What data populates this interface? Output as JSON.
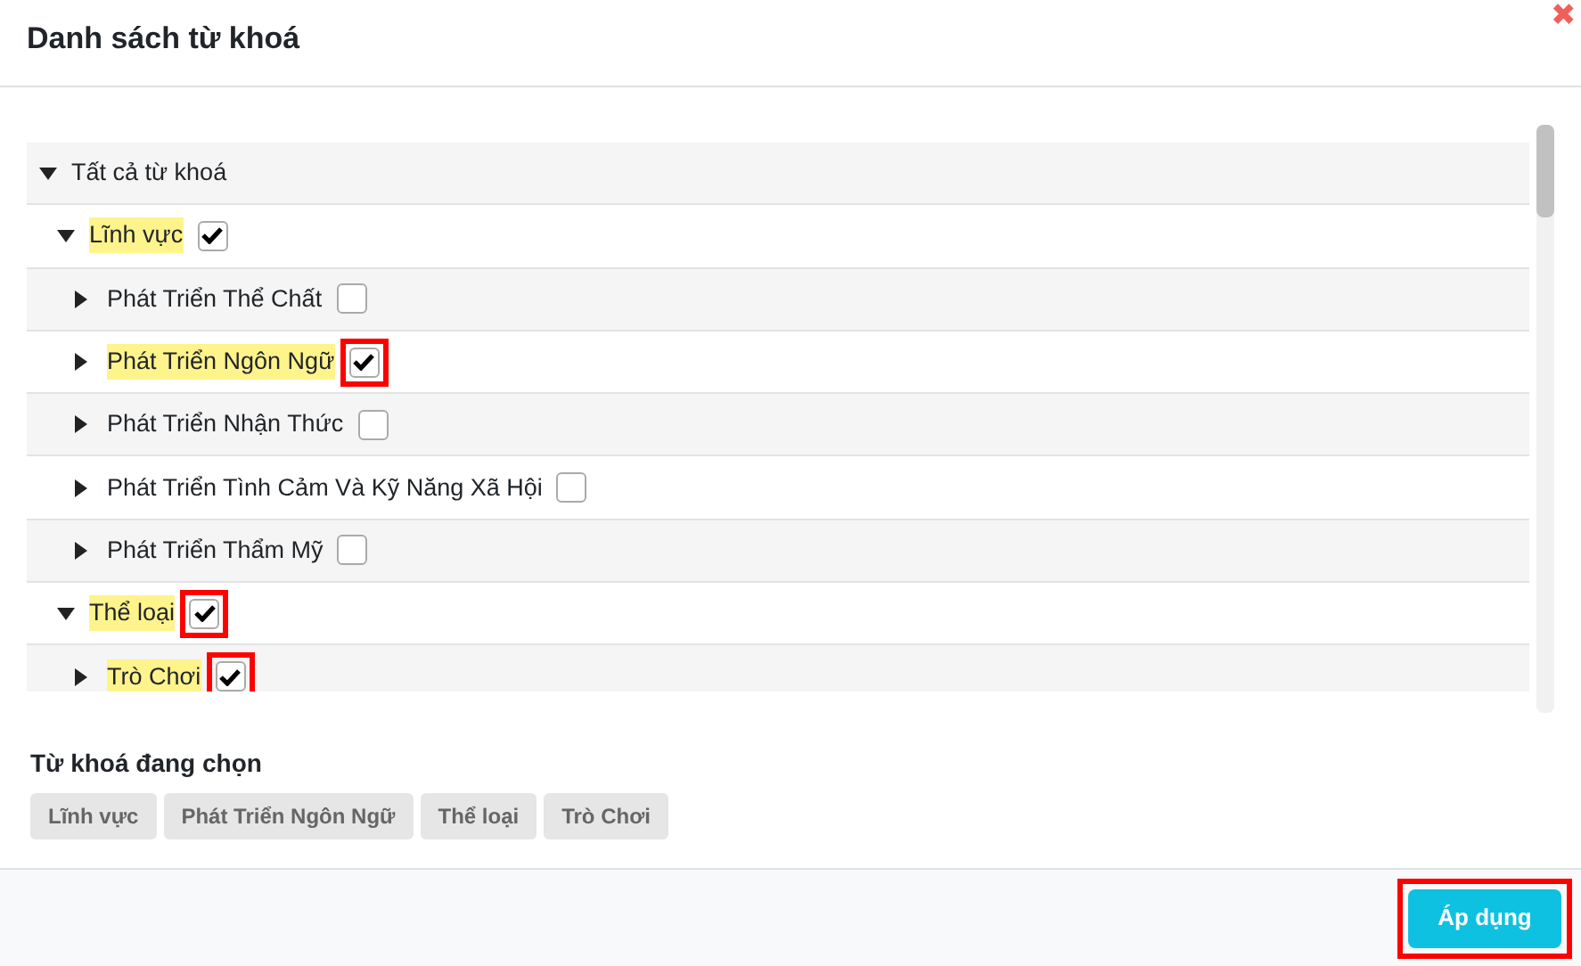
{
  "dialog": {
    "title": "Danh sách từ khoá",
    "close": "✖"
  },
  "tree": {
    "label": "Tất cả từ khoá",
    "expanded": true,
    "children": [
      {
        "label": "Lĩnh vực",
        "expanded": true,
        "checked": true,
        "outlined": false,
        "children": [
          {
            "label": "Phát Triển Thể Chất",
            "expanded": false,
            "checked": false,
            "outlined": false
          },
          {
            "label": "Phát Triển Ngôn Ngữ",
            "expanded": false,
            "checked": true,
            "outlined": true
          },
          {
            "label": "Phát Triển Nhận Thức",
            "expanded": false,
            "checked": false,
            "outlined": false
          },
          {
            "label": "Phát Triển Tình Cảm Và Kỹ Năng Xã Hội",
            "expanded": false,
            "checked": false,
            "outlined": false
          },
          {
            "label": "Phát Triển Thẩm Mỹ",
            "expanded": false,
            "checked": false,
            "outlined": false
          }
        ]
      },
      {
        "label": "Thể loại",
        "expanded": true,
        "checked": true,
        "outlined": true,
        "children": [
          {
            "label": "Trò Chơi",
            "expanded": false,
            "checked": true,
            "outlined": true
          }
        ]
      }
    ]
  },
  "selected_section": {
    "title": "Từ khoá đang chọn",
    "chips": [
      "Lĩnh vực",
      "Phát Triển Ngôn Ngữ",
      "Thể loại",
      "Trò Chơi"
    ]
  },
  "apply_button": {
    "label": "Áp dụng",
    "outlined": true
  }
}
